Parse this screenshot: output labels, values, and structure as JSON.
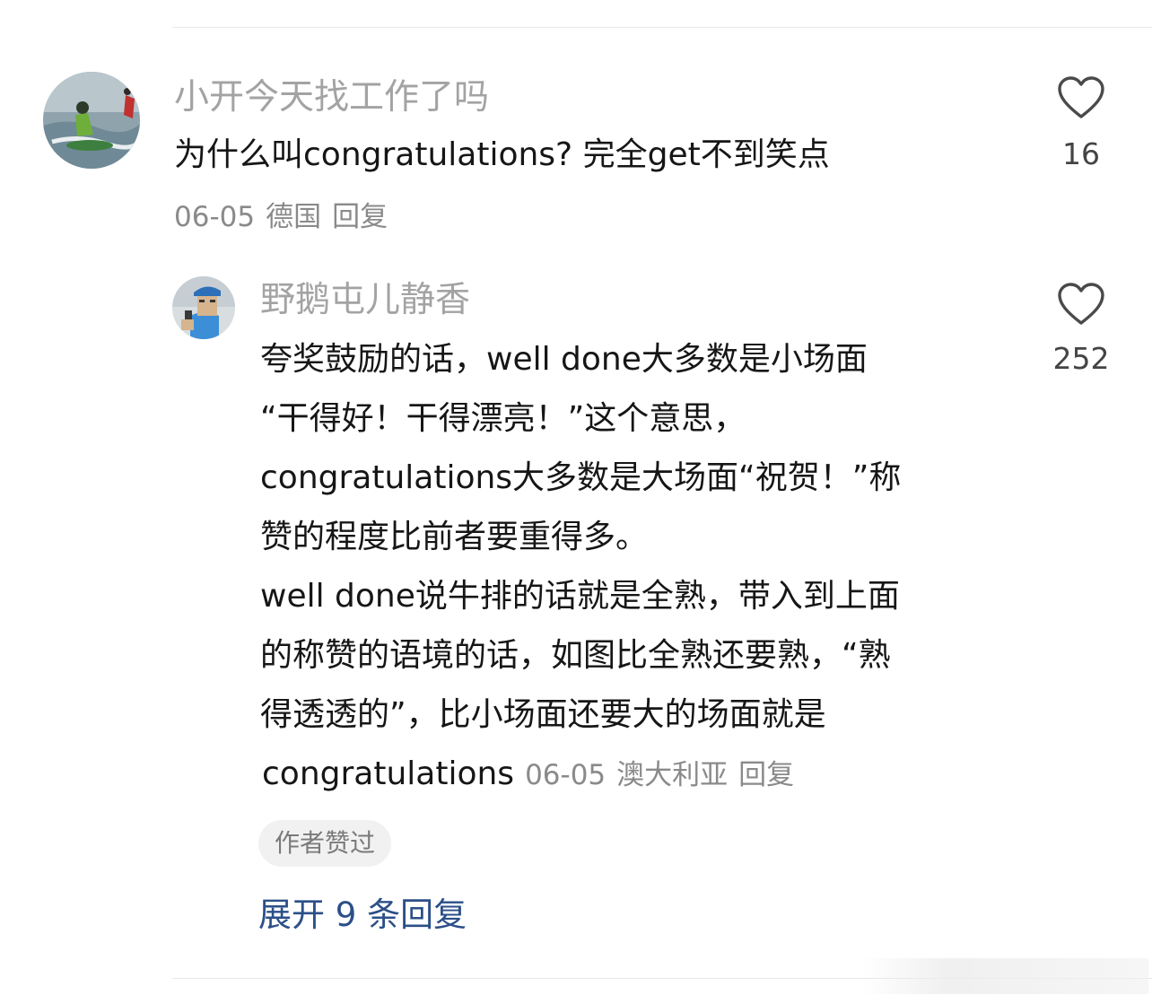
{
  "comment": {
    "username": "小开今天找工作了吗",
    "text": "为什么叫congratulations? 完全get不到笑点",
    "date": "06-05",
    "location": "德国",
    "reply_label": "回复",
    "likes": "16"
  },
  "reply": {
    "username": "野鹅屯儿静香",
    "lines": [
      "夸奖鼓励的话，well done大多数是小场面",
      "“干得好！干得漂亮！”这个意思，",
      "congratulations大多数是大场面“祝贺！”称",
      "赞的程度比前者要重得多。",
      "well done说牛排的话就是全熟，带入到上面",
      "的称赞的语境的话，如图比全熟还要熟，“熟",
      "得透透的”，比小场面还要大的场面就是",
      "congratulations"
    ],
    "date": "06-05",
    "location": "澳大利亚",
    "reply_label": "回复",
    "likes": "252",
    "badge": "作者赞过"
  },
  "expand_replies": "展开 9 条回复",
  "icons": {
    "like": "heart-outline-icon"
  },
  "colors": {
    "link_blue": "#2b4f88",
    "username_gray": "#a3a3a3",
    "meta_gray": "#8a8a8a"
  }
}
